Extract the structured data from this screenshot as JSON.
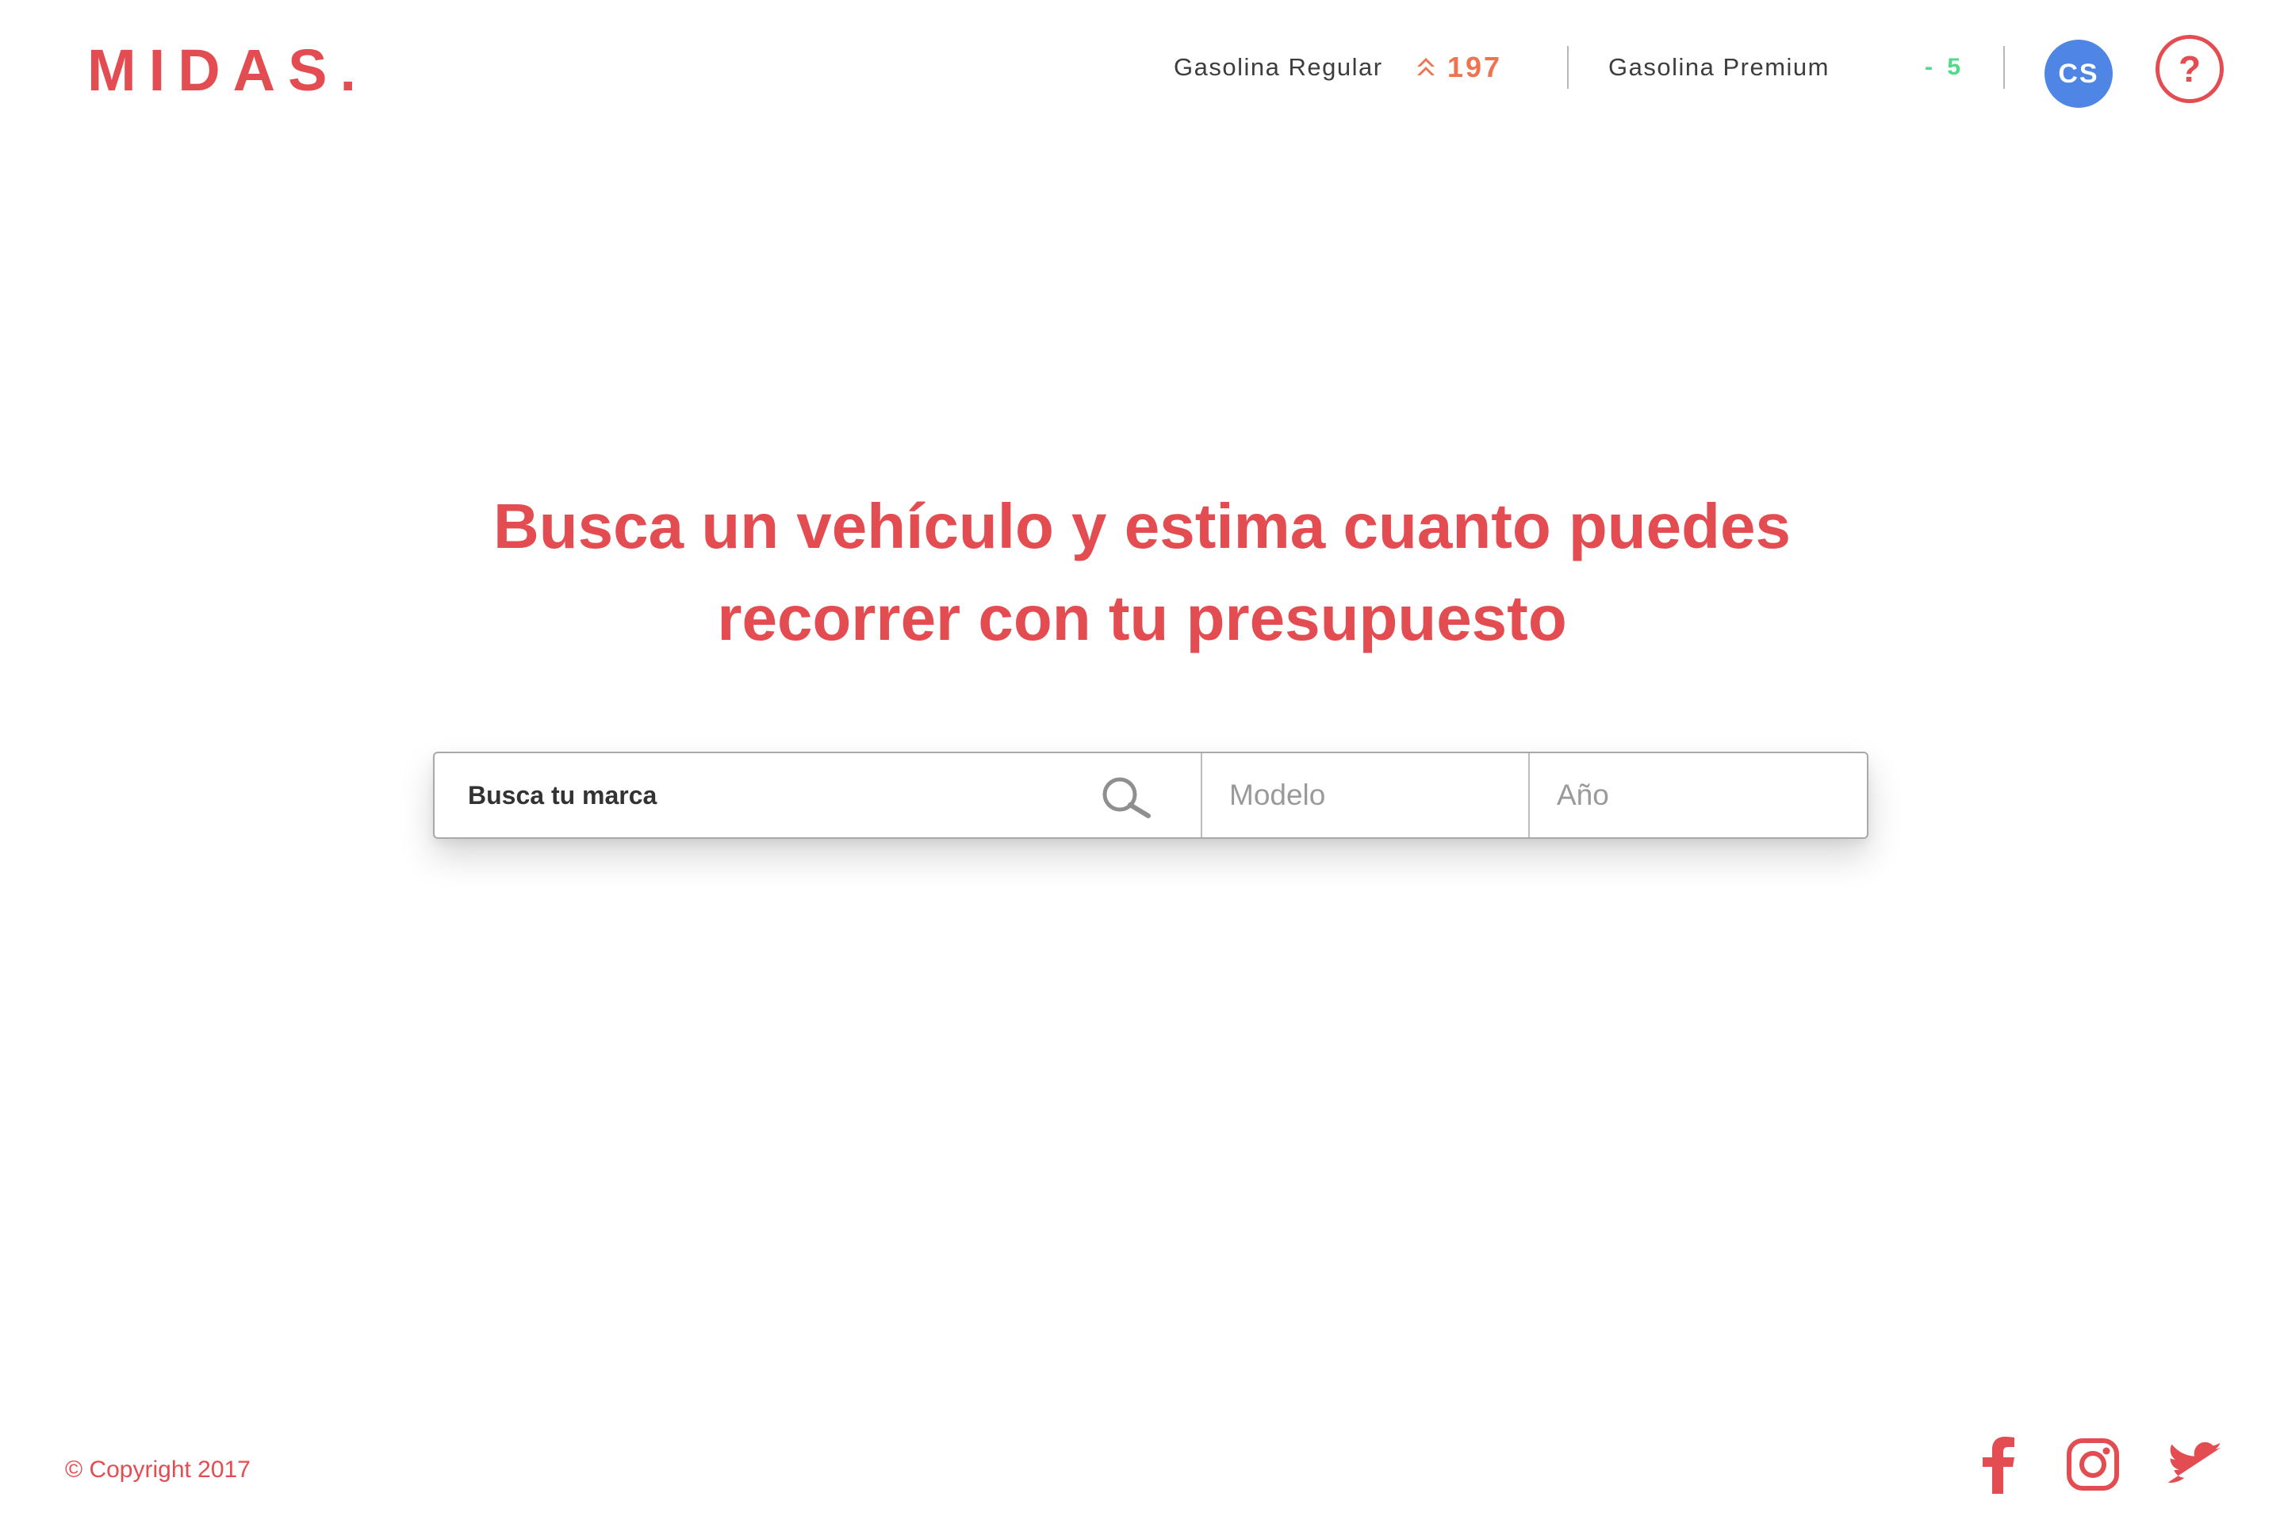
{
  "header": {
    "logo": "MIDAS.",
    "fuel_regular": {
      "label": "Gasolina Regular",
      "change": "197",
      "trend": "up"
    },
    "fuel_premium": {
      "label": "Gasolina Premium",
      "change": "- 5",
      "trend": "down"
    },
    "avatar_initials": "CS",
    "help_symbol": "?"
  },
  "hero": {
    "title_line1": "Busca un vehículo y estima cuanto puedes",
    "title_line2": "recorrer con tu presupuesto"
  },
  "search": {
    "brand_placeholder": "Busca tu marca",
    "model_placeholder": "Modelo",
    "year_placeholder": "Año",
    "icon": "search-icon"
  },
  "footer": {
    "copyright": "© Copyright 2017",
    "social": [
      "facebook-icon",
      "instagram-icon",
      "twitter-icon"
    ]
  },
  "colors": {
    "brand": "#e34c51",
    "trend_up": "#ef7350",
    "trend_down": "#4ddc88",
    "avatar": "#4f86e6"
  }
}
